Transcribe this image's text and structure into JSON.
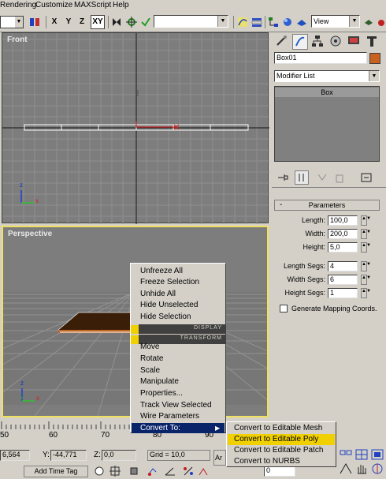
{
  "menu": {
    "items": [
      "Rendering",
      "Customize",
      "MAXScript",
      "Help"
    ]
  },
  "toolbar": {
    "axis_x": "X",
    "axis_y": "Y",
    "axis_z": "Z",
    "axis_xy": "XY",
    "named_sel_value": "",
    "ref_coord": "View"
  },
  "viewports": {
    "front_label": "Front",
    "perspective_label": "Perspective"
  },
  "command_panel": {
    "object_name": "Box01",
    "object_color": "#c86020",
    "modifier_list": "Modifier List",
    "stack_item": "Box",
    "rollout_sign": "-",
    "rollout_title": "Parameters",
    "params": [
      {
        "label": "Length:",
        "value": "100,0"
      },
      {
        "label": "Width:",
        "value": "200,0"
      },
      {
        "label": "Height:",
        "value": "5,0"
      },
      {
        "label": "Length Segs:",
        "value": "4"
      },
      {
        "label": "Width Segs:",
        "value": "6"
      },
      {
        "label": "Height Segs:",
        "value": "1"
      }
    ],
    "gen_mapping": "Generate Mapping Coords."
  },
  "context_menu": {
    "display_group": [
      "Unfreeze All",
      "Freeze Selection",
      "Unhide All",
      "Hide Unselected",
      "Hide Selection"
    ],
    "display_header": "DISPLAY",
    "transform_header": "TRANSFORM",
    "transform_group": [
      "Move",
      "Rotate",
      "Scale",
      "Manipulate",
      "Properties...",
      "Track View Selected",
      "Wire Parameters"
    ],
    "convert_to": "Convert To:"
  },
  "submenu": {
    "items": [
      "Convert to Editable Mesh",
      "Convert to Editable Poly",
      "Convert to Editable Patch",
      "Convert to NURBS"
    ],
    "highlighted_index": 1
  },
  "timeline": {
    "ticks": [
      "50",
      "60",
      "70",
      "80",
      "90"
    ]
  },
  "status": {
    "x_value": "6,564",
    "y_label": "Y:",
    "y_value": "-44,771",
    "z_label": "Z:",
    "z_value": "0,0",
    "grid": "Grid = 10,0",
    "add_time_tag": "Add Time Tag",
    "partial_btn": "Ar",
    "frame_value": "0"
  }
}
